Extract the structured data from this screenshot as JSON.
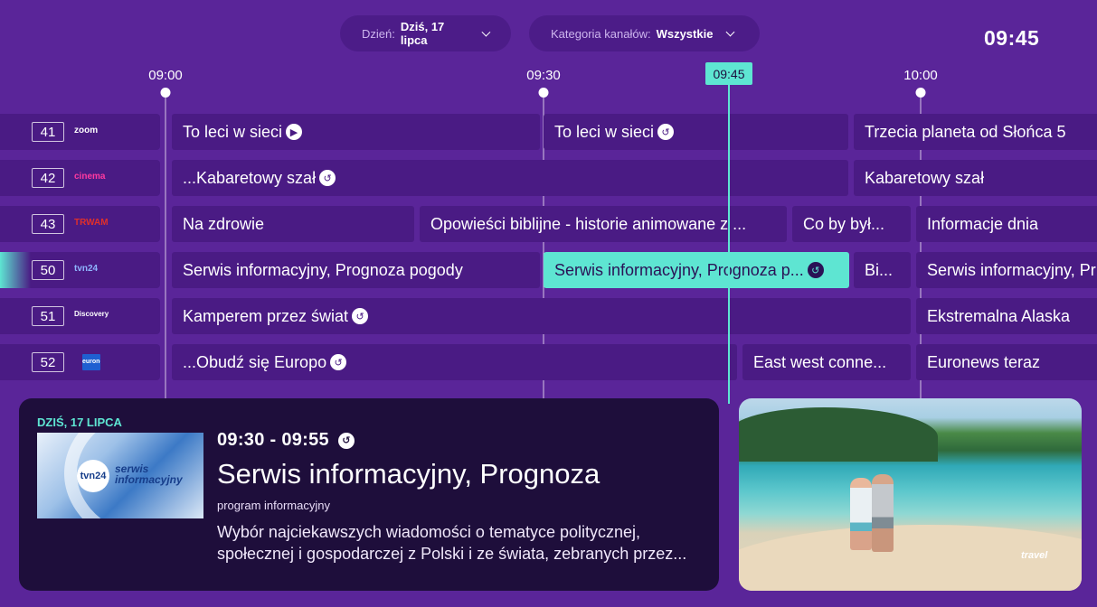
{
  "header": {
    "day_filter": {
      "label": "Dzień:",
      "value": "Dziś, 17 lipca"
    },
    "category_filter": {
      "label": "Kategoria kanałów:",
      "value": "Wszystkie"
    },
    "clock": "09:45"
  },
  "timeline": {
    "ticks": [
      "09:00",
      "09:30",
      "10:00"
    ],
    "now_label": "09:45"
  },
  "channels": [
    {
      "number": "41",
      "logo": "zoom",
      "logo_color": "#ffffff",
      "programs": [
        {
          "title": "To leci w sieci",
          "icon": "play"
        },
        {
          "title": "To leci w sieci",
          "icon": "replay"
        },
        {
          "title": "Trzecia planeta od Słońca 5",
          "icon": ""
        }
      ]
    },
    {
      "number": "42",
      "logo": "cinema",
      "logo_color": "#ff3aa0",
      "programs": [
        {
          "title": "...Kabaretowy szał",
          "icon": "replay"
        },
        {
          "title": "Kabaretowy szał",
          "icon": ""
        }
      ]
    },
    {
      "number": "43",
      "logo": "TRWAM",
      "logo_color": "#e0302a",
      "programs": [
        {
          "title": "Na zdrowie",
          "icon": ""
        },
        {
          "title": "Opowieści biblijne - historie animowane z ...",
          "icon": ""
        },
        {
          "title": "Co by był...",
          "icon": ""
        },
        {
          "title": "Informacje dnia",
          "icon": ""
        }
      ]
    },
    {
      "number": "50",
      "logo": "tvn24",
      "logo_color": "#8fb6ff",
      "active": true,
      "programs": [
        {
          "title": "Serwis informacyjny, Prognoza pogody",
          "icon": ""
        },
        {
          "title": "Serwis informacyjny, Prognoza p...",
          "icon": "replay",
          "current": true
        },
        {
          "title": "Bi...",
          "icon": ""
        },
        {
          "title": "Serwis informacyjny, Pr",
          "icon": ""
        }
      ]
    },
    {
      "number": "51",
      "logo": "Discovery",
      "logo_color": "#ffffff",
      "programs": [
        {
          "title": "Kamperem przez świat",
          "icon": "replay"
        },
        {
          "title": "Ekstremalna Alaska",
          "icon": ""
        }
      ]
    },
    {
      "number": "52",
      "logo": "euronews",
      "logo_color": "#3a8ff0",
      "programs": [
        {
          "title": "...Obudź się Europo",
          "icon": "replay"
        },
        {
          "title": "East west conne...",
          "icon": ""
        },
        {
          "title": "Euronews teraz",
          "icon": ""
        }
      ]
    }
  ],
  "details": {
    "date": "DZIŚ, 17 LIPCA",
    "time": "09:30 - 09:55",
    "title": "Serwis informacyjny, Prognoza",
    "category": "program informacyjny",
    "description": "Wybór najciekawszych wiadomości o tematyce politycznej, społecznej i gospodarczej z Polski i ze świata, zebranych przez...",
    "thumb_logo": "tvn24",
    "thumb_text_1": "serwis",
    "thumb_text_2": "informacyjny"
  },
  "preview": {
    "brand": "travel"
  },
  "colors": {
    "background": "#5a2599",
    "cell": "#4a1b84",
    "accent": "#5ee5d2",
    "panel": "#1e0e3b"
  }
}
